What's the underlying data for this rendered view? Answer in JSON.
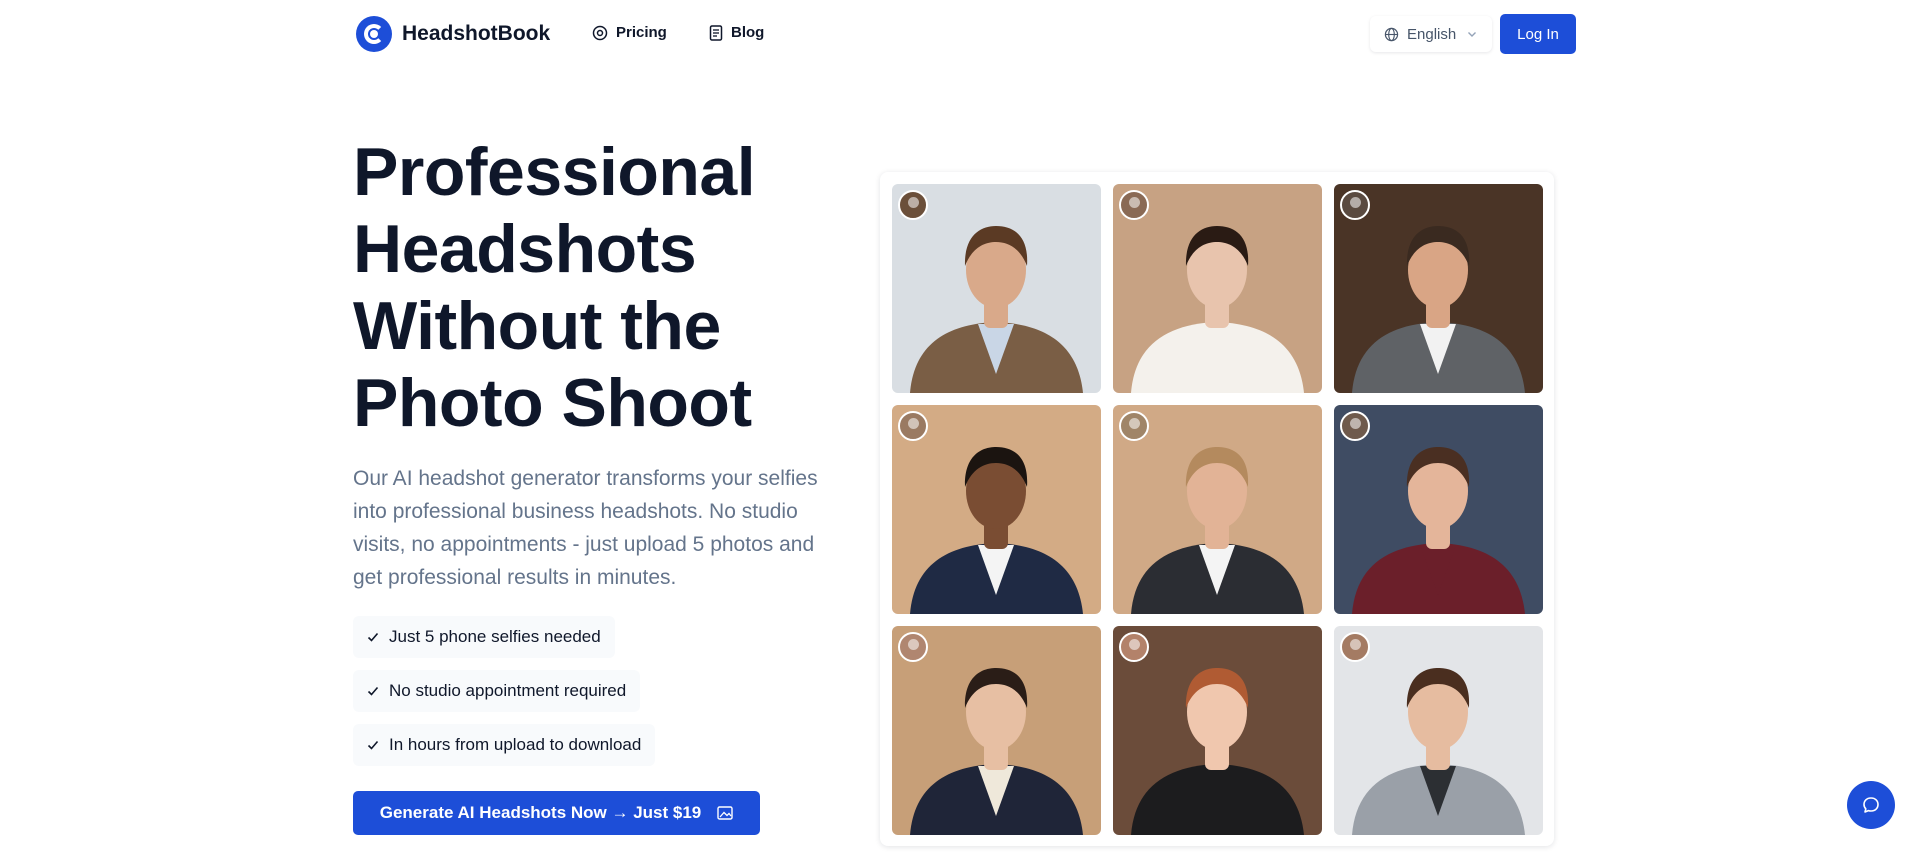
{
  "header": {
    "brand": "HeadshotBook",
    "nav": {
      "pricing": "Pricing",
      "blog": "Blog"
    },
    "language": "English",
    "login": "Log In"
  },
  "hero": {
    "title_lines": [
      "Professional",
      "Headshots",
      "Without the",
      "Photo Shoot"
    ],
    "description": "Our AI headshot generator transforms your selfies into professional business headshots. No studio visits, no appointments - just upload 5 photos and get professional results in minutes.",
    "features": [
      "Just 5 phone selfies needed",
      "No studio appointment required",
      "In hours from upload to download"
    ],
    "cta": "Generate AI Headshots Now → Just $19"
  },
  "colors": {
    "accent": "#1d4ed8",
    "text": "#0f172a",
    "muted": "#64748b"
  },
  "gallery": {
    "tiles": [
      {
        "bg": "#d9dee3",
        "suit": "#7a5e45",
        "shirt": "#c9d6e6",
        "skin": "#d9a98a",
        "hair": "#5b3a24",
        "avatar": "#6b4f3a"
      },
      {
        "bg": "#c7a283",
        "suit": "#f4f1ec",
        "shirt": "#f4f1ec",
        "skin": "#e8c4ad",
        "hair": "#2a1b14",
        "avatar": "#8a6a55"
      },
      {
        "bg": "#4a3426",
        "suit": "#5f6266",
        "shirt": "#f2f2f2",
        "skin": "#d9a585",
        "hair": "#3a2a20",
        "avatar": "#5a4a40"
      },
      {
        "bg": "#d3ab85",
        "suit": "#1f2a44",
        "shirt": "#f4f4f4",
        "skin": "#7a4d33",
        "hair": "#1b1410",
        "avatar": "#9a7a62"
      },
      {
        "bg": "#d0a986",
        "suit": "#2b2d33",
        "shirt": "#f4f4f4",
        "skin": "#e2b396",
        "hair": "#b48a5e",
        "avatar": "#a08568"
      },
      {
        "bg": "#3f4c63",
        "suit": "#6b1f2a",
        "shirt": "#6b1f2a",
        "skin": "#e4b59a",
        "hair": "#4a2f22",
        "avatar": "#6f5a4c"
      },
      {
        "bg": "#c79f78",
        "suit": "#1f2538",
        "shirt": "#efe8da",
        "skin": "#e7bfa3",
        "hair": "#2a1d17",
        "avatar": "#b08670"
      },
      {
        "bg": "#6b4c3a",
        "suit": "#1c1c1e",
        "shirt": "#1c1c1e",
        "skin": "#f0c7ae",
        "hair": "#b05b33",
        "avatar": "#b3826a"
      },
      {
        "bg": "#e3e5e8",
        "suit": "#9aa0a8",
        "shirt": "#2c2f33",
        "skin": "#e6bca0",
        "hair": "#4a2e1f",
        "avatar": "#a47b63"
      }
    ]
  }
}
